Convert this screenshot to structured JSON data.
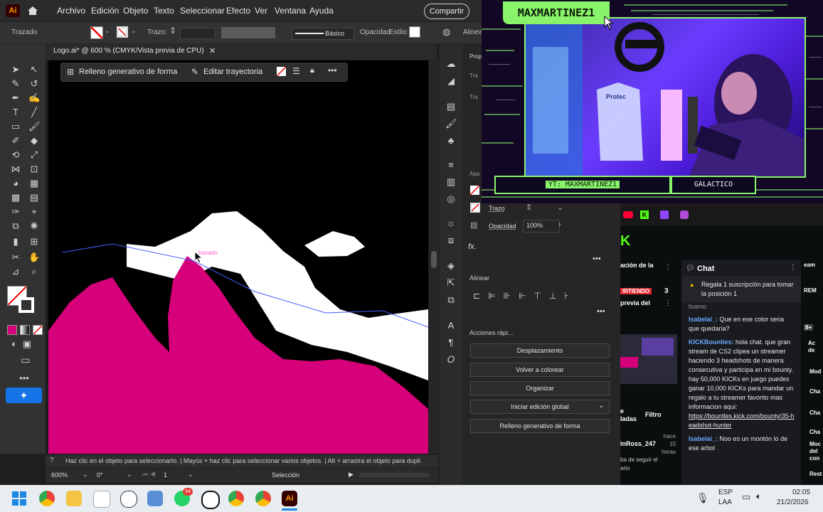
{
  "menubar": {
    "logo": "Ai",
    "items": [
      "Archivo",
      "Edición",
      "Objeto",
      "Texto",
      "Seleccionar",
      "Efecto",
      "Ver",
      "Ventana",
      "Ayuda"
    ],
    "share": "Compartir"
  },
  "control": {
    "object_type": "Trazado",
    "stroke_label": "Trazo:",
    "stroke_style": "Básico",
    "opacity_label": "Opacidad",
    "style_label": "Estilo:",
    "align_label": "Alinea"
  },
  "document": {
    "tab_title": "Logo.ai* @ 600 % (CMYK/Vista previa de CPU)",
    "context_gen_fill": "Relleno generativo de forma",
    "context_edit_path": "Editar trayectoria",
    "cursor_tooltip": "trazado"
  },
  "status": {
    "hint": "Haz clic en el objeto para seleccionarlo.  |  Mayús + haz clic para seleccionar varios objetos.  |  Alt + arrastra el objeto para dupli",
    "zoom": "600%",
    "rotation": "0°",
    "artboard": "1",
    "tool": "Selección"
  },
  "properties": {
    "stroke_label": "Trazo",
    "opacity_label": "Opacidad",
    "opacity_value": "100%",
    "fx_label": "fx.",
    "align_title": "Alinear",
    "quick_actions_title": "Acciones rápi...",
    "buttons": [
      "Desplazamiento",
      "Volver a colorear",
      "Organizar",
      "Iniciar edición global",
      "Relleno generativo de forma"
    ],
    "side_labels": [
      "Prop",
      "Tra",
      "Tra",
      "Apa"
    ]
  },
  "stream": {
    "streamer_name": "MAXMARTINEZ1",
    "yt_label": "YT: MAXMARTINEZ1",
    "rank_label": "GALACTICO",
    "camera_brand": "Protec"
  },
  "kick": {
    "logo": "K",
    "left_col": [
      "ación de la",
      "IRTIENDO",
      "previa del",
      "e",
      "ladas",
      "inRoss_247",
      "ba de seguir el",
      "ario"
    ],
    "live_badge_count": "3",
    "chat_title": "Chat",
    "pinned": "Regala 1 suscripción para tomar la posición 1",
    "messages": [
      {
        "user": "",
        "text": "bueno"
      },
      {
        "user": "Isabelai_:",
        "text": "Que en ese color seria que quedaria?"
      },
      {
        "user": "KICKBounties:",
        "text": "hola chat. que gran stream de CS2 clipea un streamer haciendo 3 headshots de manera consecutiva y participa en mi bounty. hay 50,000 KICKs en juego puedes ganar 10,000 KICKs para mandar un regalo a tu streamer favorito mas informacion aqui:"
      },
      {
        "user": "",
        "link": "https://bountles.kick.com/bounty/35-headshot-hunter"
      },
      {
        "user": "Isabelai_:",
        "text": "Noo es un montón lo de ese arbol"
      }
    ],
    "filter_label": "Filtro",
    "time_label": "hace 10 horas",
    "right_col": [
      "eam",
      "REM",
      "8+",
      "Ac",
      "de",
      "Mod",
      "Cha",
      "Cha",
      "Cha",
      "Moc del con",
      "Rest"
    ]
  },
  "taskbar": {
    "lang": "ESP",
    "region": "LAA",
    "time": "02:05",
    "date": "21/2/2026",
    "badge_count": "54"
  },
  "colors": {
    "accent_green": "#8af36c",
    "magenta": "#d6007a",
    "ai_orange": "#ff9a00",
    "kick_green": "#53fc18"
  }
}
